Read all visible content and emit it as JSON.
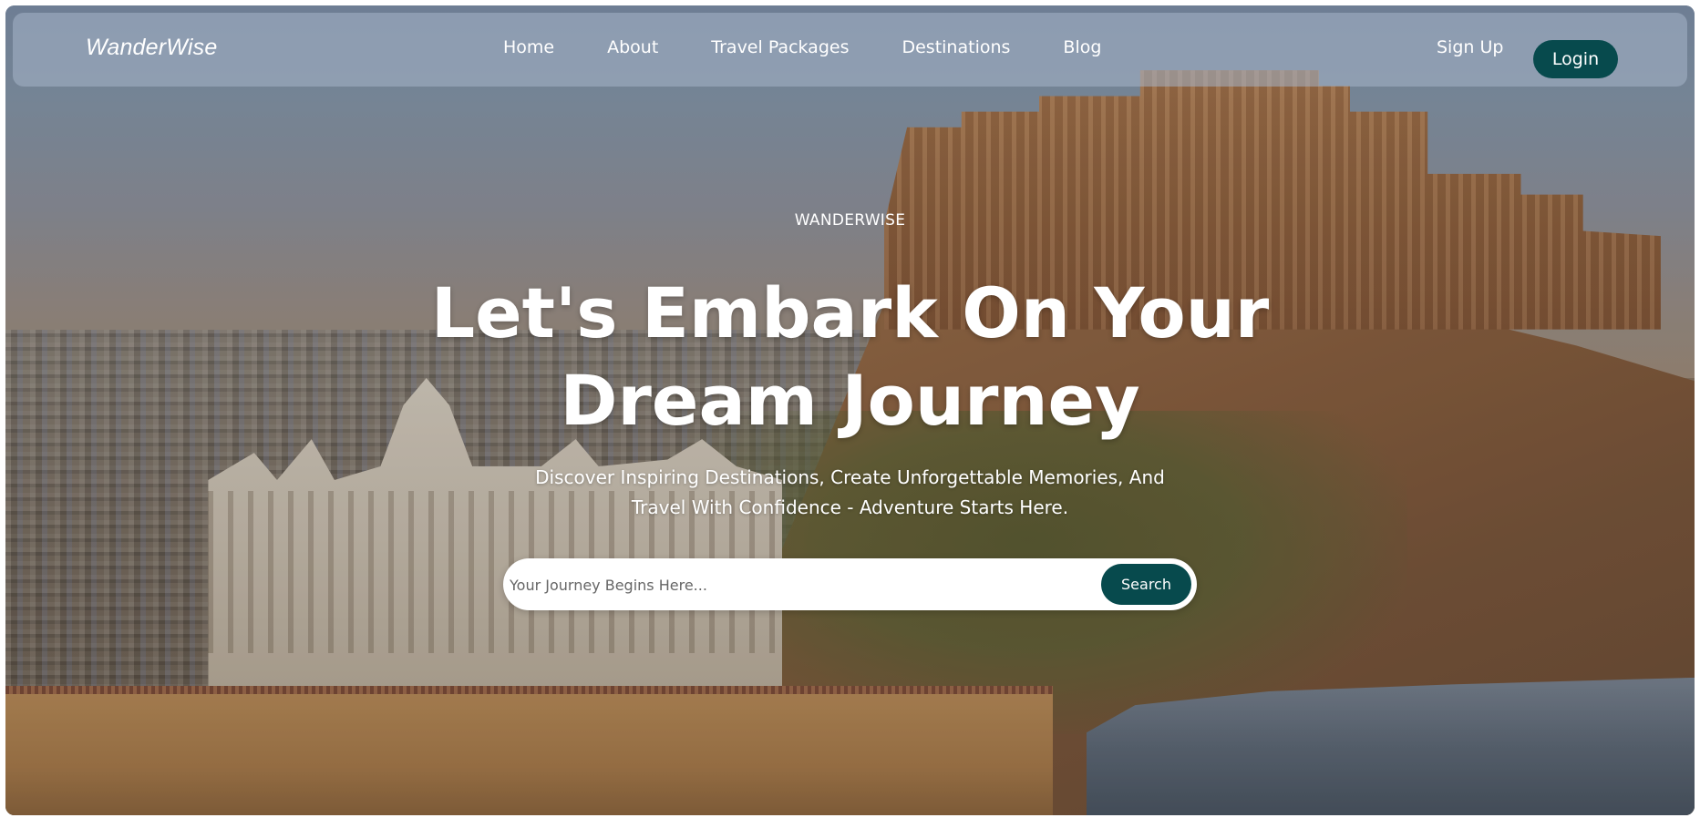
{
  "nav": {
    "brand": "WanderWise",
    "links": [
      {
        "label": "Home"
      },
      {
        "label": "About"
      },
      {
        "label": "Travel Packages"
      },
      {
        "label": "Destinations"
      },
      {
        "label": "Blog"
      }
    ],
    "signup_label": "Sign Up",
    "login_label": "Login"
  },
  "hero": {
    "eyebrow": "WANDERWISE",
    "headline_line1": "Let's Embark On Your",
    "headline_line2": "Dream Journey",
    "subtext_line1": "Discover Inspiring Destinations, Create Unforgettable Memories, And",
    "subtext_line2": "Travel With Confidence - Adventure Starts Here."
  },
  "search": {
    "placeholder": "Your Journey Begins Here...",
    "value": "",
    "button_label": "Search"
  },
  "colors": {
    "accent": "#074a4d",
    "text_on_hero": "#ffffff"
  }
}
